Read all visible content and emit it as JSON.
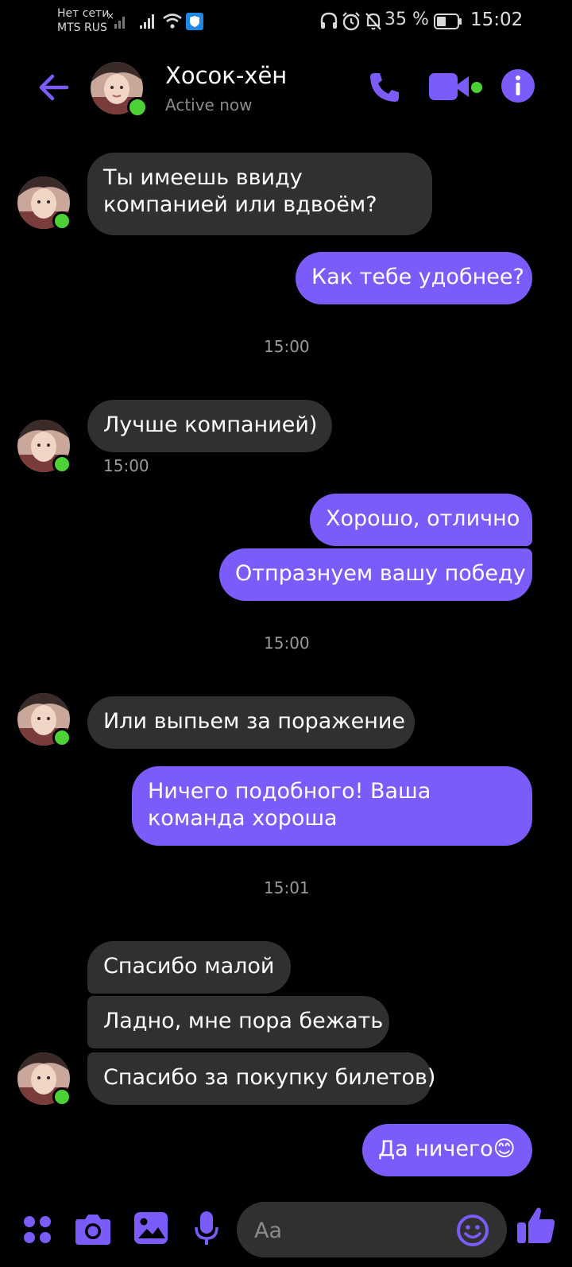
{
  "status_bar": {
    "carrier_line1": "Нет сети",
    "carrier_line2": "MTS RUS",
    "battery": "35 %",
    "time": "15:02"
  },
  "header": {
    "contact_name": "Хосок-хён",
    "contact_status": "Active now"
  },
  "messages": [
    {
      "id": "m1",
      "dir": "in",
      "text_lines": [
        "Ты имеешь ввиду",
        "компанией или вдвоём?"
      ]
    },
    {
      "id": "m2",
      "dir": "out",
      "text": "Как тебе удобнее?"
    },
    {
      "id": "t1",
      "type": "time",
      "text": "15:00"
    },
    {
      "id": "m3",
      "dir": "in",
      "text": "Лучше компанией)",
      "sub_time": "15:00"
    },
    {
      "id": "m4",
      "dir": "out",
      "text": "Хорошо, отлично"
    },
    {
      "id": "m5",
      "dir": "out",
      "text": "Отпразнуем вашу победу"
    },
    {
      "id": "t2",
      "type": "time",
      "text": "15:00"
    },
    {
      "id": "m6",
      "dir": "in",
      "text": "Или выпьем за поражение"
    },
    {
      "id": "m7",
      "dir": "out",
      "text_lines": [
        "Ничего подобного! Ваша",
        "команда хороша"
      ]
    },
    {
      "id": "t3",
      "type": "time",
      "text": "15:01"
    },
    {
      "id": "m8",
      "dir": "in",
      "text": "Спасибо малой"
    },
    {
      "id": "m9",
      "dir": "in",
      "text": "Ладно, мне пора бежать"
    },
    {
      "id": "m10",
      "dir": "in",
      "text": "Спасибо за покупку билетов)"
    },
    {
      "id": "m11",
      "dir": "out",
      "text": "Да ничего😊"
    }
  ],
  "composer": {
    "placeholder": "Aa"
  },
  "colors": {
    "accent": "#7b5cfa",
    "incoming_bubble": "#303030",
    "online": "#4cd137",
    "background": "#000000"
  },
  "icons": [
    "back-arrow-icon",
    "phone-icon",
    "video-camera-icon",
    "info-icon",
    "apps-icon",
    "camera-icon",
    "gallery-icon",
    "microphone-icon",
    "emoji-icon",
    "thumbs-up-icon"
  ]
}
